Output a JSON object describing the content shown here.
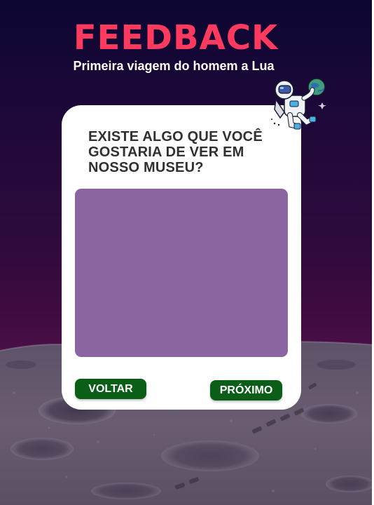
{
  "header": {
    "title": "FEEDBACK",
    "subtitle": "Primeira viagem do homem a Lua"
  },
  "card": {
    "question": "EXISTE ALGO QUE VOCÊ\nGOSTARIA DE VER EM\nNOSSO MUSEU?",
    "answer_value": ""
  },
  "buttons": {
    "back_label": "VOLTAR",
    "next_label": "PRÓXIMO"
  },
  "icons": {
    "illustration": "astronaut-icon"
  },
  "colors": {
    "title": "#ff3a5e",
    "background_top": "#0d0631",
    "background_mid": "#3f0b40",
    "answer_box": "#8b64a2",
    "button": "#0b5e18",
    "card": "#ffffff"
  }
}
